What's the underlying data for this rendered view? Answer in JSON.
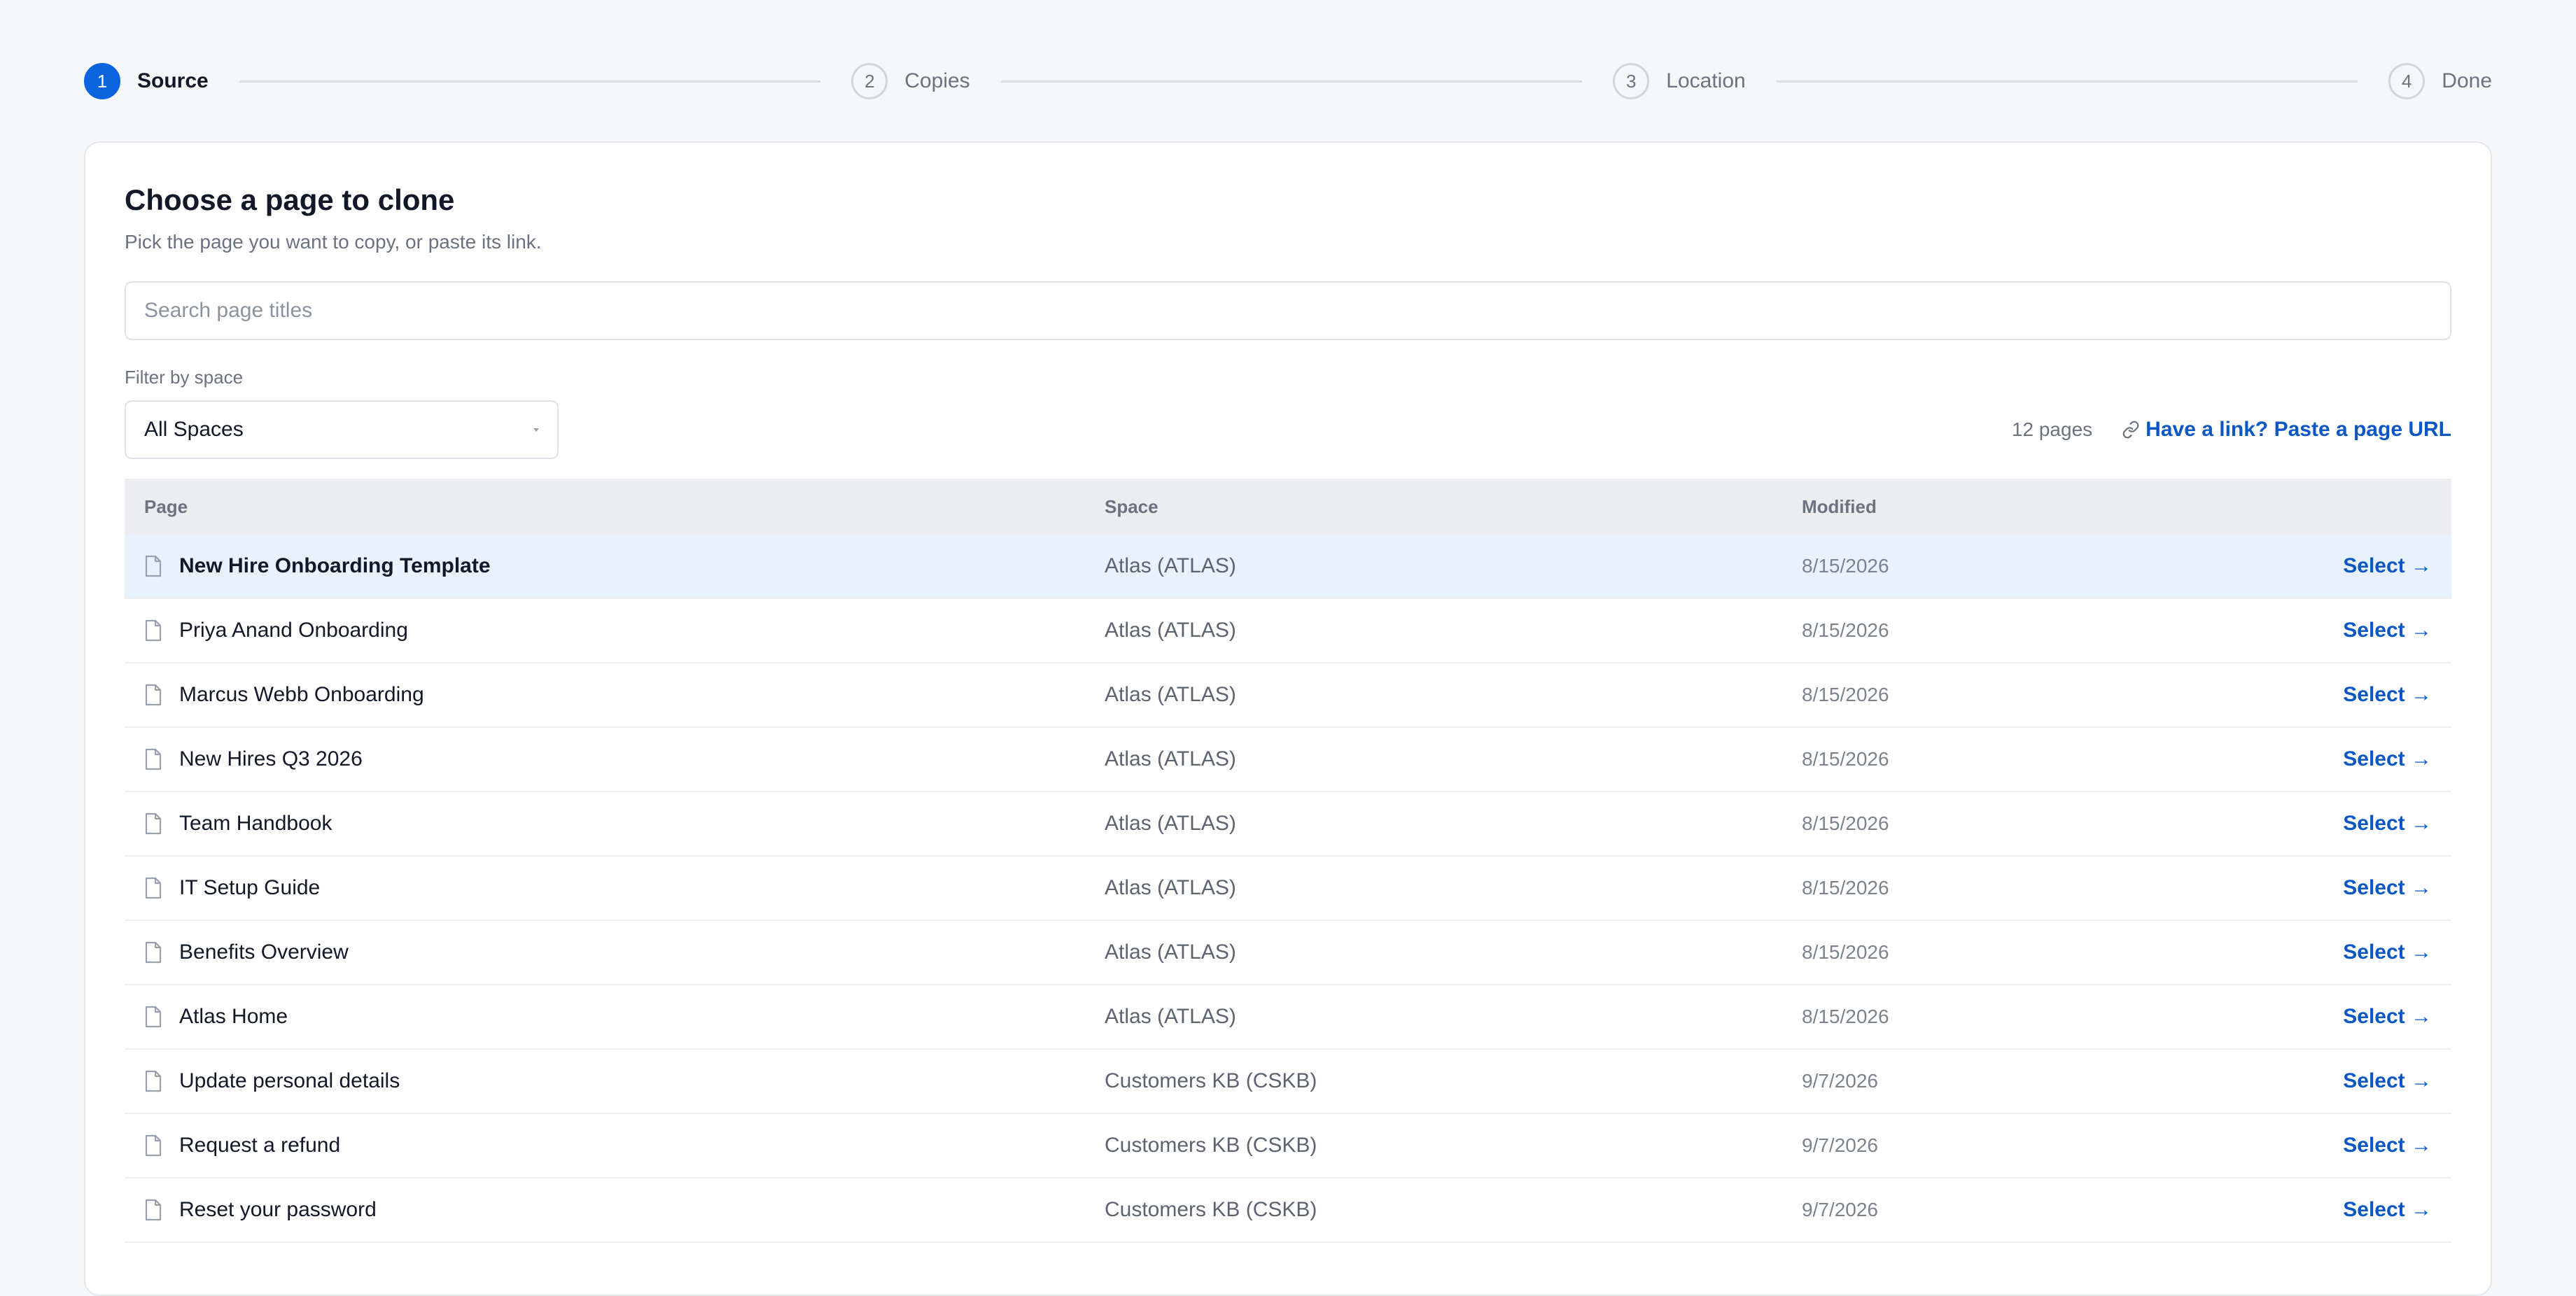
{
  "stepper": {
    "steps": [
      {
        "number": "1",
        "label": "Source"
      },
      {
        "number": "2",
        "label": "Copies"
      },
      {
        "number": "3",
        "label": "Location"
      },
      {
        "number": "4",
        "label": "Done"
      }
    ],
    "active": 0
  },
  "card": {
    "title": "Choose a page to clone",
    "subtitle": "Pick the page you want to copy, or paste its link."
  },
  "search": {
    "placeholder": "Search page titles",
    "value": ""
  },
  "filter": {
    "label": "Filter by space",
    "selected": "All Spaces"
  },
  "meta": {
    "count": "12 pages",
    "paste_link": "Have a link? Paste a page URL"
  },
  "table": {
    "columns": {
      "page": "Page",
      "space": "Space",
      "modified": "Modified"
    },
    "action_label": "Select →",
    "rows": [
      {
        "page": "New Hire Onboarding Template",
        "space": "Atlas (ATLAS)",
        "modified": "8/15/2026"
      },
      {
        "page": "Priya Anand Onboarding",
        "space": "Atlas (ATLAS)",
        "modified": "8/15/2026"
      },
      {
        "page": "Marcus Webb Onboarding",
        "space": "Atlas (ATLAS)",
        "modified": "8/15/2026"
      },
      {
        "page": "New Hires Q3 2026",
        "space": "Atlas (ATLAS)",
        "modified": "8/15/2026"
      },
      {
        "page": "Team Handbook",
        "space": "Atlas (ATLAS)",
        "modified": "8/15/2026"
      },
      {
        "page": "IT Setup Guide",
        "space": "Atlas (ATLAS)",
        "modified": "8/15/2026"
      },
      {
        "page": "Benefits Overview",
        "space": "Atlas (ATLAS)",
        "modified": "8/15/2026"
      },
      {
        "page": "Atlas Home",
        "space": "Atlas (ATLAS)",
        "modified": "8/15/2026"
      },
      {
        "page": "Update personal details",
        "space": "Customers KB (CSKB)",
        "modified": "9/7/2026"
      },
      {
        "page": "Request a refund",
        "space": "Customers KB (CSKB)",
        "modified": "9/7/2026"
      },
      {
        "page": "Reset your password",
        "space": "Customers KB (CSKB)",
        "modified": "9/7/2026"
      }
    ]
  },
  "colors": {
    "accent": "#0b63de",
    "link": "#0b57c5",
    "highlight_row": "#e8f2fd"
  }
}
